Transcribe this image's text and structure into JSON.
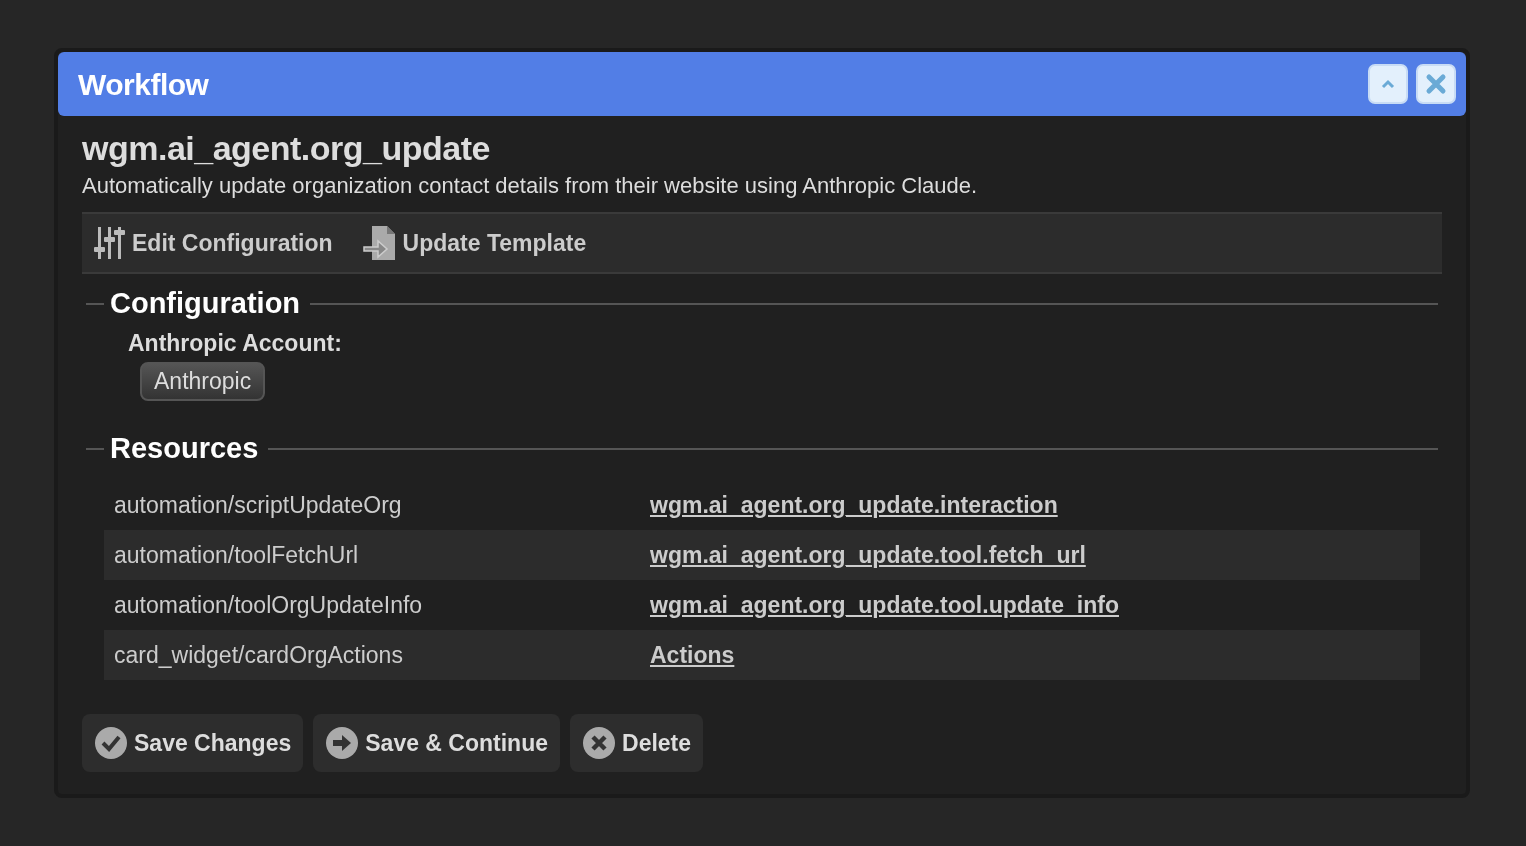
{
  "window": {
    "title": "Workflow",
    "controls": [
      {
        "kind": "collapse"
      },
      {
        "kind": "close"
      }
    ]
  },
  "workflow": {
    "name": "wgm.ai_agent.org_update",
    "description": "Automatically update organization contact details from their website using Anthropic Claude."
  },
  "toolbar": [
    {
      "kind": "configure",
      "label": "Edit Configuration"
    },
    {
      "kind": "template",
      "label": "Update Template"
    }
  ],
  "configuration": {
    "title": "Configuration",
    "fields": [
      {
        "label": "Anthropic Account:",
        "value": "Anthropic"
      }
    ]
  },
  "resources": {
    "title": "Resources",
    "rows": [
      {
        "name": "automation/scriptUpdateOrg",
        "link": "wgm.ai_agent.org_update.interaction"
      },
      {
        "name": "automation/toolFetchUrl",
        "link": "wgm.ai_agent.org_update.tool.fetch_url"
      },
      {
        "name": "automation/toolOrgUpdateInfo",
        "link": "wgm.ai_agent.org_update.tool.update_info"
      },
      {
        "name": "card_widget/cardOrgActions",
        "link": "Actions"
      }
    ]
  },
  "buttons": [
    {
      "kind": "save",
      "label": "Save Changes"
    },
    {
      "kind": "continue",
      "label": "Save & Continue"
    },
    {
      "kind": "delete",
      "label": "Delete"
    }
  ]
}
